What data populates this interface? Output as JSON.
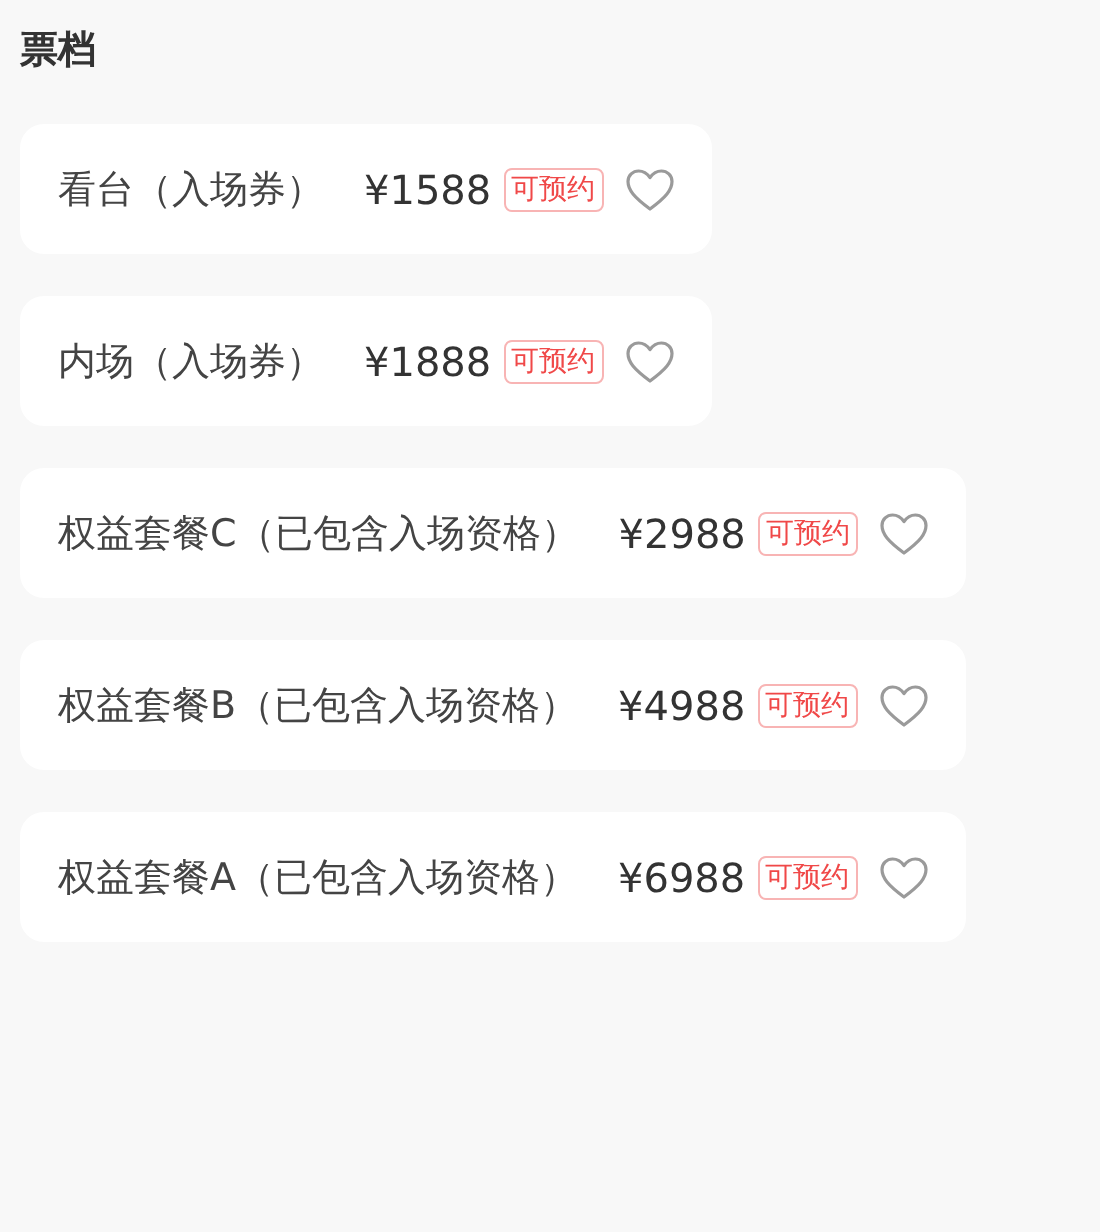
{
  "section_title": "票档",
  "tickets": [
    {
      "name": "看台（入场券）",
      "price": "¥1588",
      "tag": "可预约"
    },
    {
      "name": "内场（入场券）",
      "price": "¥1888",
      "tag": "可预约"
    },
    {
      "name": "权益套餐C（已包含入场资格）",
      "price": "¥2988",
      "tag": "可预约"
    },
    {
      "name": "权益套餐B（已包含入场资格）",
      "price": "¥4988",
      "tag": "可预约"
    },
    {
      "name": "权益套餐A（已包含入场资格）",
      "price": "¥6988",
      "tag": "可预约"
    }
  ]
}
